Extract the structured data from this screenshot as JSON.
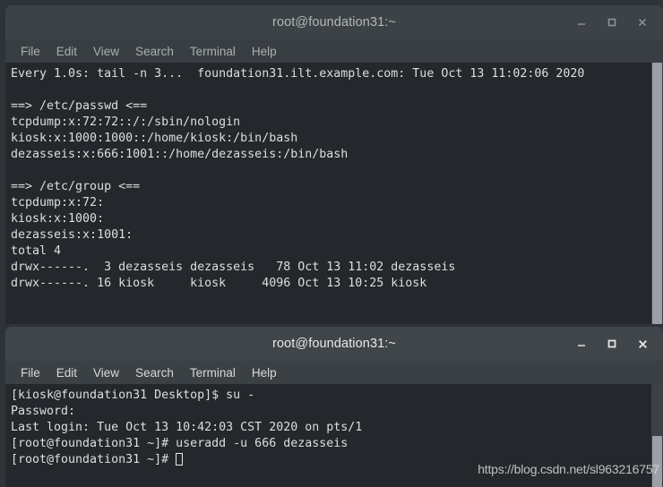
{
  "desktop": {
    "background": "#2e3338"
  },
  "windows": [
    {
      "id": "watch-terminal",
      "title": "root@foundation31:~",
      "state": "inactive",
      "menu": [
        "File",
        "Edit",
        "View",
        "Search",
        "Terminal",
        "Help"
      ],
      "buttons": {
        "minimize": "minimize-button",
        "maximize": "maximize-button",
        "close": "close-button"
      },
      "lines": [
        "Every 1.0s: tail -n 3...  foundation31.ilt.example.com: Tue Oct 13 11:02:06 2020",
        "",
        "==> /etc/passwd <==",
        "tcpdump:x:72:72::/:/sbin/nologin",
        "kiosk:x:1000:1000::/home/kiosk:/bin/bash",
        "dezasseis:x:666:1001::/home/dezasseis:/bin/bash",
        "",
        "==> /etc/group <==",
        "tcpdump:x:72:",
        "kiosk:x:1000:",
        "dezasseis:x:1001:",
        "total 4",
        "drwx------.  3 dezasseis dezasseis   78 Oct 13 11:02 dezasseis",
        "drwx------. 16 kiosk     kiosk     4096 Oct 13 10:25 kiosk"
      ]
    },
    {
      "id": "root-terminal",
      "title": "root@foundation31:~",
      "state": "active",
      "menu": [
        "File",
        "Edit",
        "View",
        "Search",
        "Terminal",
        "Help"
      ],
      "buttons": {
        "minimize": "minimize-button",
        "maximize": "maximize-button",
        "close": "close-button"
      },
      "lines": [
        "[kiosk@foundation31 Desktop]$ su -",
        "Password:",
        "Last login: Tue Oct 13 10:42:03 CST 2020 on pts/1",
        "[root@foundation31 ~]# useradd -u 666 dezasseis",
        "[root@foundation31 ~]# "
      ]
    }
  ],
  "watermark": "https://blog.csdn.net/sl963216757",
  "colors": {
    "terminal_bg": "#24282c",
    "terminal_fg": "#dcdfe1",
    "titlebar_bg": "#3e4448",
    "menubar_bg": "#383e42",
    "scrollbar_thumb": "#9aa0a5"
  }
}
